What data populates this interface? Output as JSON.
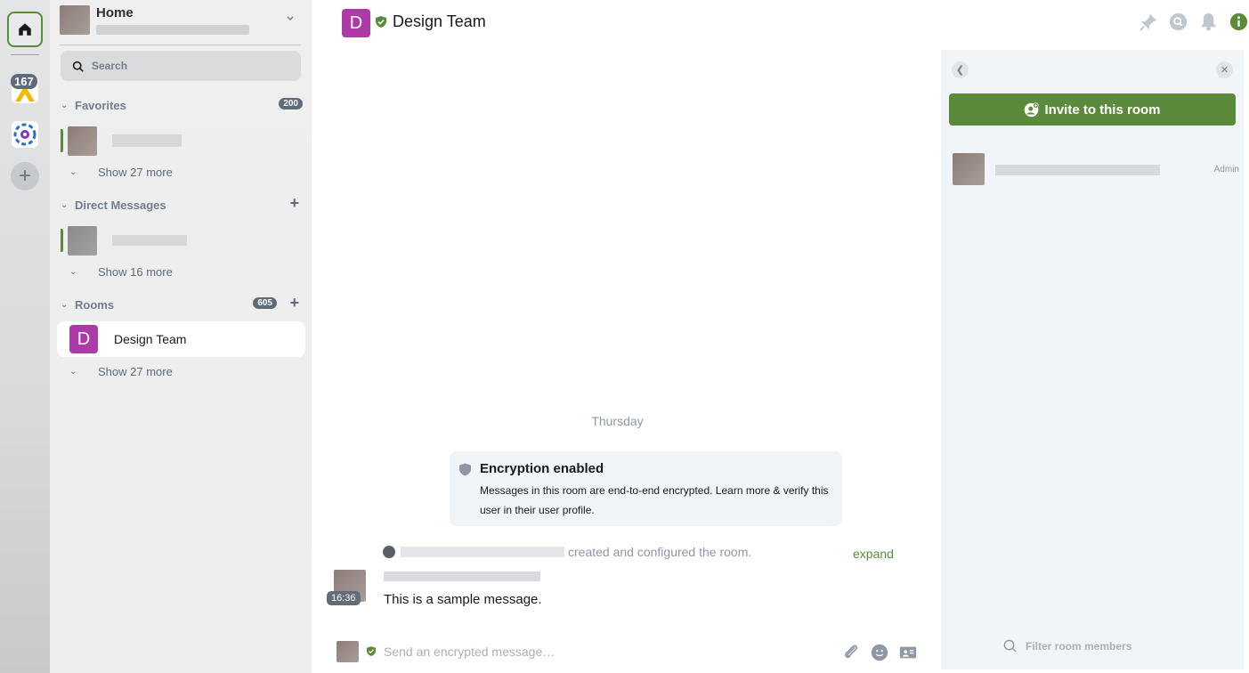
{
  "spaces": {
    "home_label": "Home",
    "badge_count": "167",
    "add_label": "+"
  },
  "roomlist": {
    "title": "Home",
    "search_label": "Search",
    "favorites": {
      "label": "Favorites",
      "count": "200",
      "show_more": "Show 27 more"
    },
    "direct_messages": {
      "label": "Direct Messages",
      "show_more": "Show 16 more"
    },
    "rooms": {
      "label": "Rooms",
      "count": "605",
      "selected_initial": "D",
      "selected_name": "Design Team",
      "show_more": "Show 27 more"
    }
  },
  "header": {
    "avatar_initial": "D",
    "title": "Design Team"
  },
  "timeline": {
    "day": "Thursday",
    "encryption_title": "Encryption enabled",
    "encryption_body": "Messages in this room are end-to-end encrypted. Learn more & verify this user in their user profile.",
    "created_text": "created and configured the room.",
    "expand_label": "expand",
    "message_time": "16:36",
    "message_body": "This is a sample message."
  },
  "composer": {
    "placeholder": "Send an encrypted message…"
  },
  "right_panel": {
    "invite_label": "Invite to this room",
    "member_role": "Admin",
    "filter_placeholder": "Filter room members"
  },
  "colors": {
    "accent": "#5c8a3b",
    "room_avatar": "#ac3ba8",
    "badge": "#5f6b7a"
  }
}
